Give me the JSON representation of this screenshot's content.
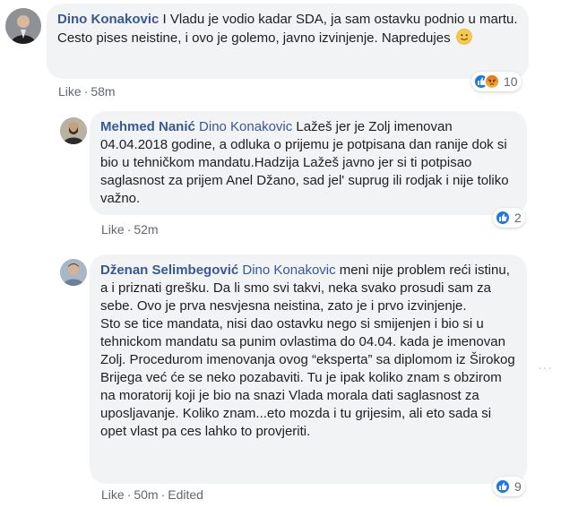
{
  "comments": [
    {
      "author": "Dino Konakovic",
      "mention": "",
      "text": " I Vladu je vodio kadar SDA, ja sam ostavku podnio u martu.\nCesto pises neistine, i ovo je golemo, javno izvinjenje. Napredujes ",
      "emoji": "slightly-smiling-face",
      "like_label": "Like",
      "time": "58m",
      "edited": "",
      "reaction_count": "10",
      "reactions": [
        "like-reaction",
        "angry-reaction"
      ]
    },
    {
      "author": "Mehmed Nanić",
      "mention": "Dino Konakovic",
      "text": " Lažeš jer je Zolj imenovan 04.04.2018 godine, a odluka o prijemu je potpisana dan ranije dok si bio u tehničkom mandatu.Hadzija Lažeš javno jer si ti potpisao saglasnost za prijem Anel Džano, sad jel' suprug ili rodjak i nije toliko važno.",
      "like_label": "Like",
      "time": "52m",
      "edited": "",
      "reaction_count": "2",
      "reactions": [
        "like-reaction"
      ]
    },
    {
      "author": "Dženan Selimbegović",
      "mention": "Dino Konakovic",
      "text": " meni nije problem reći istinu, a i priznati grešku. Da li smo svi takvi, neka svako prosudi sam za sebe. Ovo je prva nesvjesna neistina, zato je i prvo izvinjenje.\nSto se tice mandata, nisi dao ostavku nego si smijenjen i bio si u tehnickom mandatu sa punim ovlastima do 04.04. kada je imenovan Zolj. Procedurom imenovanja ovog “eksperta” sa diplomom iz Širokog Brijega već će se neko pozabaviti. Tu je ipak koliko znam s obzirom na moratorij koji je bio na snazi Vlada morala dati saglasnost za uposljavanje. Koliko znam...eto mozda i tu grijesim, ali eto sada si opet vlast pa ces lahko to provjeriti.",
      "like_label": "Like",
      "time": "50m",
      "edited": "Edited",
      "reaction_count": "9",
      "reactions": [
        "like-reaction"
      ]
    }
  ],
  "more_options": "···",
  "colors": {
    "link": "#385898",
    "bubble": "#f2f3f5",
    "meta": "#606770",
    "like_blue": "#1877f2"
  }
}
